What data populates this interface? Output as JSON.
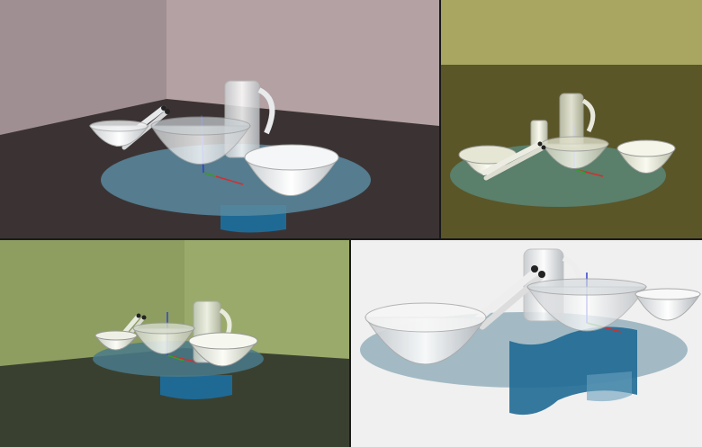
{
  "viewports": [
    {
      "id": "perspective-1",
      "background": "#b09ea0",
      "floor": "#3c3434"
    },
    {
      "id": "perspective-2",
      "background": "#a8a660",
      "floor": "#5a5628"
    },
    {
      "id": "perspective-3",
      "background": "#98a868",
      "floor": "#3a4030"
    },
    {
      "id": "perspective-4",
      "background": "#f0f0f0",
      "floor": "#f0f0f0"
    }
  ],
  "colors": {
    "table_top": "#5a8aa0",
    "table_base": "#1f6a95",
    "glass": "#e4e8ea",
    "axis_x": "#d03030",
    "axis_y": "#30a030",
    "axis_z": "#3040d0"
  },
  "objects": [
    "table-top",
    "table-base",
    "glass-bowl-small",
    "glass-bowl-large",
    "glass-bowl-open",
    "glass-pitcher",
    "salad-servers"
  ]
}
